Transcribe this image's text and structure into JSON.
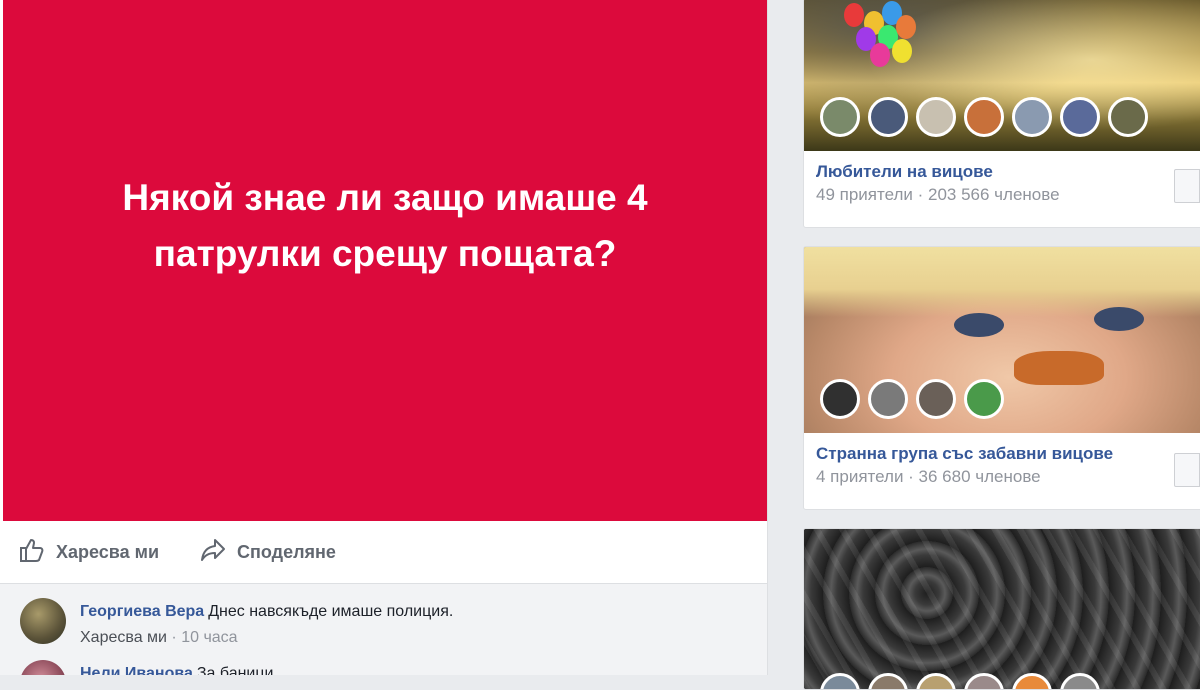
{
  "post": {
    "image_text": "Някой знае ли защо имаше 4 патрулки срещу пощата?",
    "image_bg": "#dc0a3c",
    "actions": {
      "like_label": "Харесва ми",
      "share_label": "Споделяне"
    }
  },
  "comments": [
    {
      "author": "Георгиева Вера",
      "text": "Днес навсякъде имаше полиция.",
      "like_label": "Харесва ми",
      "time": "10 часа"
    },
    {
      "author": "Нели Иванова",
      "text": "За баници"
    }
  ],
  "groups": [
    {
      "name": "Любители на вицове",
      "meta": "49 приятели · 203 566 членове"
    },
    {
      "name": "Странна група със забавни вицове",
      "meta": "4 приятели · 36 680 членове"
    },
    {
      "name": ""
    }
  ],
  "colors": {
    "link": "#365899",
    "meta": "#90949c",
    "background": "#e9ebee"
  },
  "icons": {
    "like": "thumbs-up-icon",
    "share": "share-arrow-icon"
  }
}
